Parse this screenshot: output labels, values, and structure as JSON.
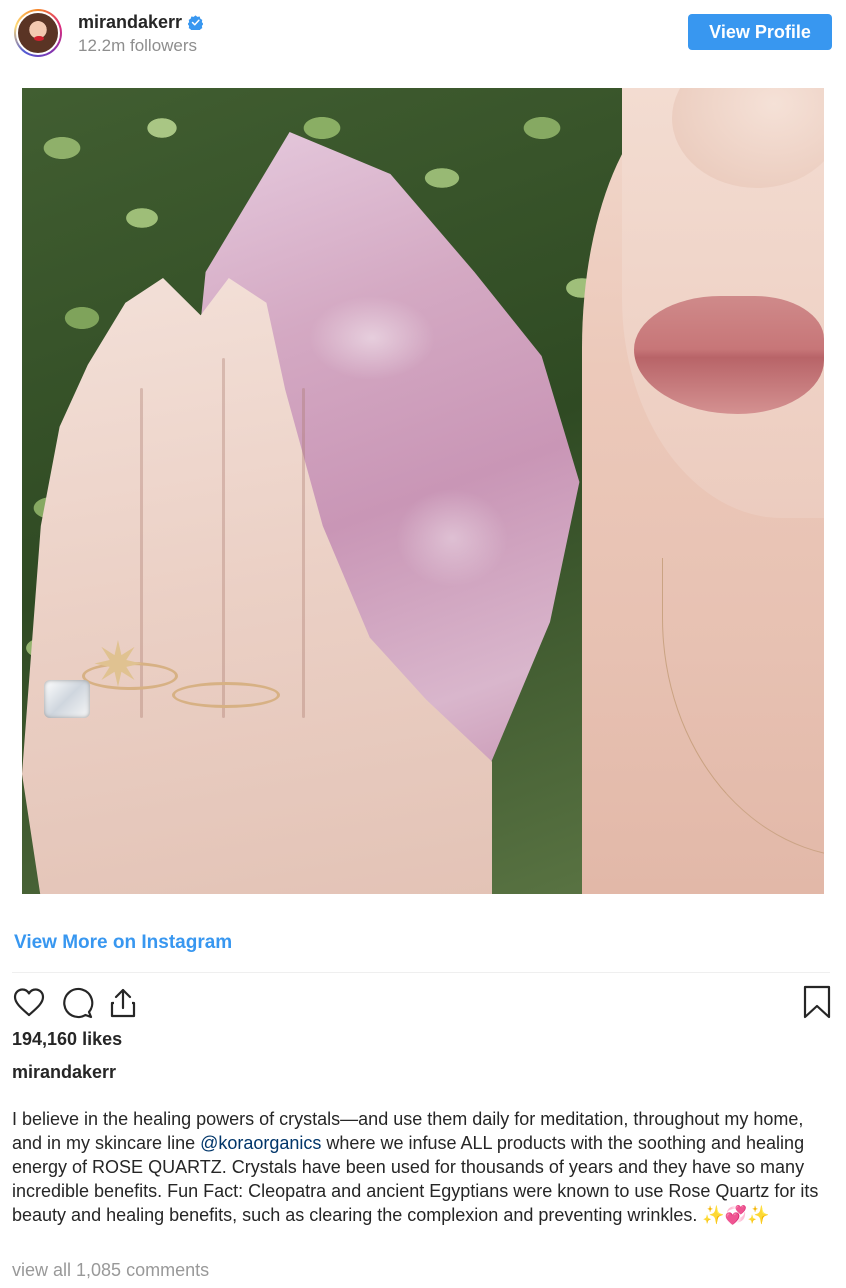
{
  "header": {
    "username": "mirandakerr",
    "verified": true,
    "followers": "12.2m followers",
    "view_profile_label": "View Profile"
  },
  "post": {
    "view_more_label": "View More on Instagram",
    "likes": "194,160 likes",
    "caption_username": "mirandakerr",
    "caption_before_mention": "I believe in the healing powers of crystals—and use them daily for meditation, throughout my home, and in my skincare line ",
    "caption_mention": "@koraorganics",
    "caption_after_mention": " where we infuse ALL products with the soothing and healing energy of ROSE QUARTZ. Crystals have been used for thousands of years and they have so many incredible benefits. Fun Fact: Cleopatra and ancient Egyptians were known to use Rose Quartz for its beauty and healing benefits, such as clearing the complexion and preventing wrinkles. ✨💞✨",
    "comments_link": "view all 1,085 comments"
  },
  "icons": {
    "verified": "verified-badge-icon",
    "like": "heart-icon",
    "comment": "comment-bubble-icon",
    "share": "share-icon",
    "save": "bookmark-icon"
  },
  "colors": {
    "accent": "#3897f0",
    "mention": "#003569",
    "muted": "#8e8e8e"
  }
}
